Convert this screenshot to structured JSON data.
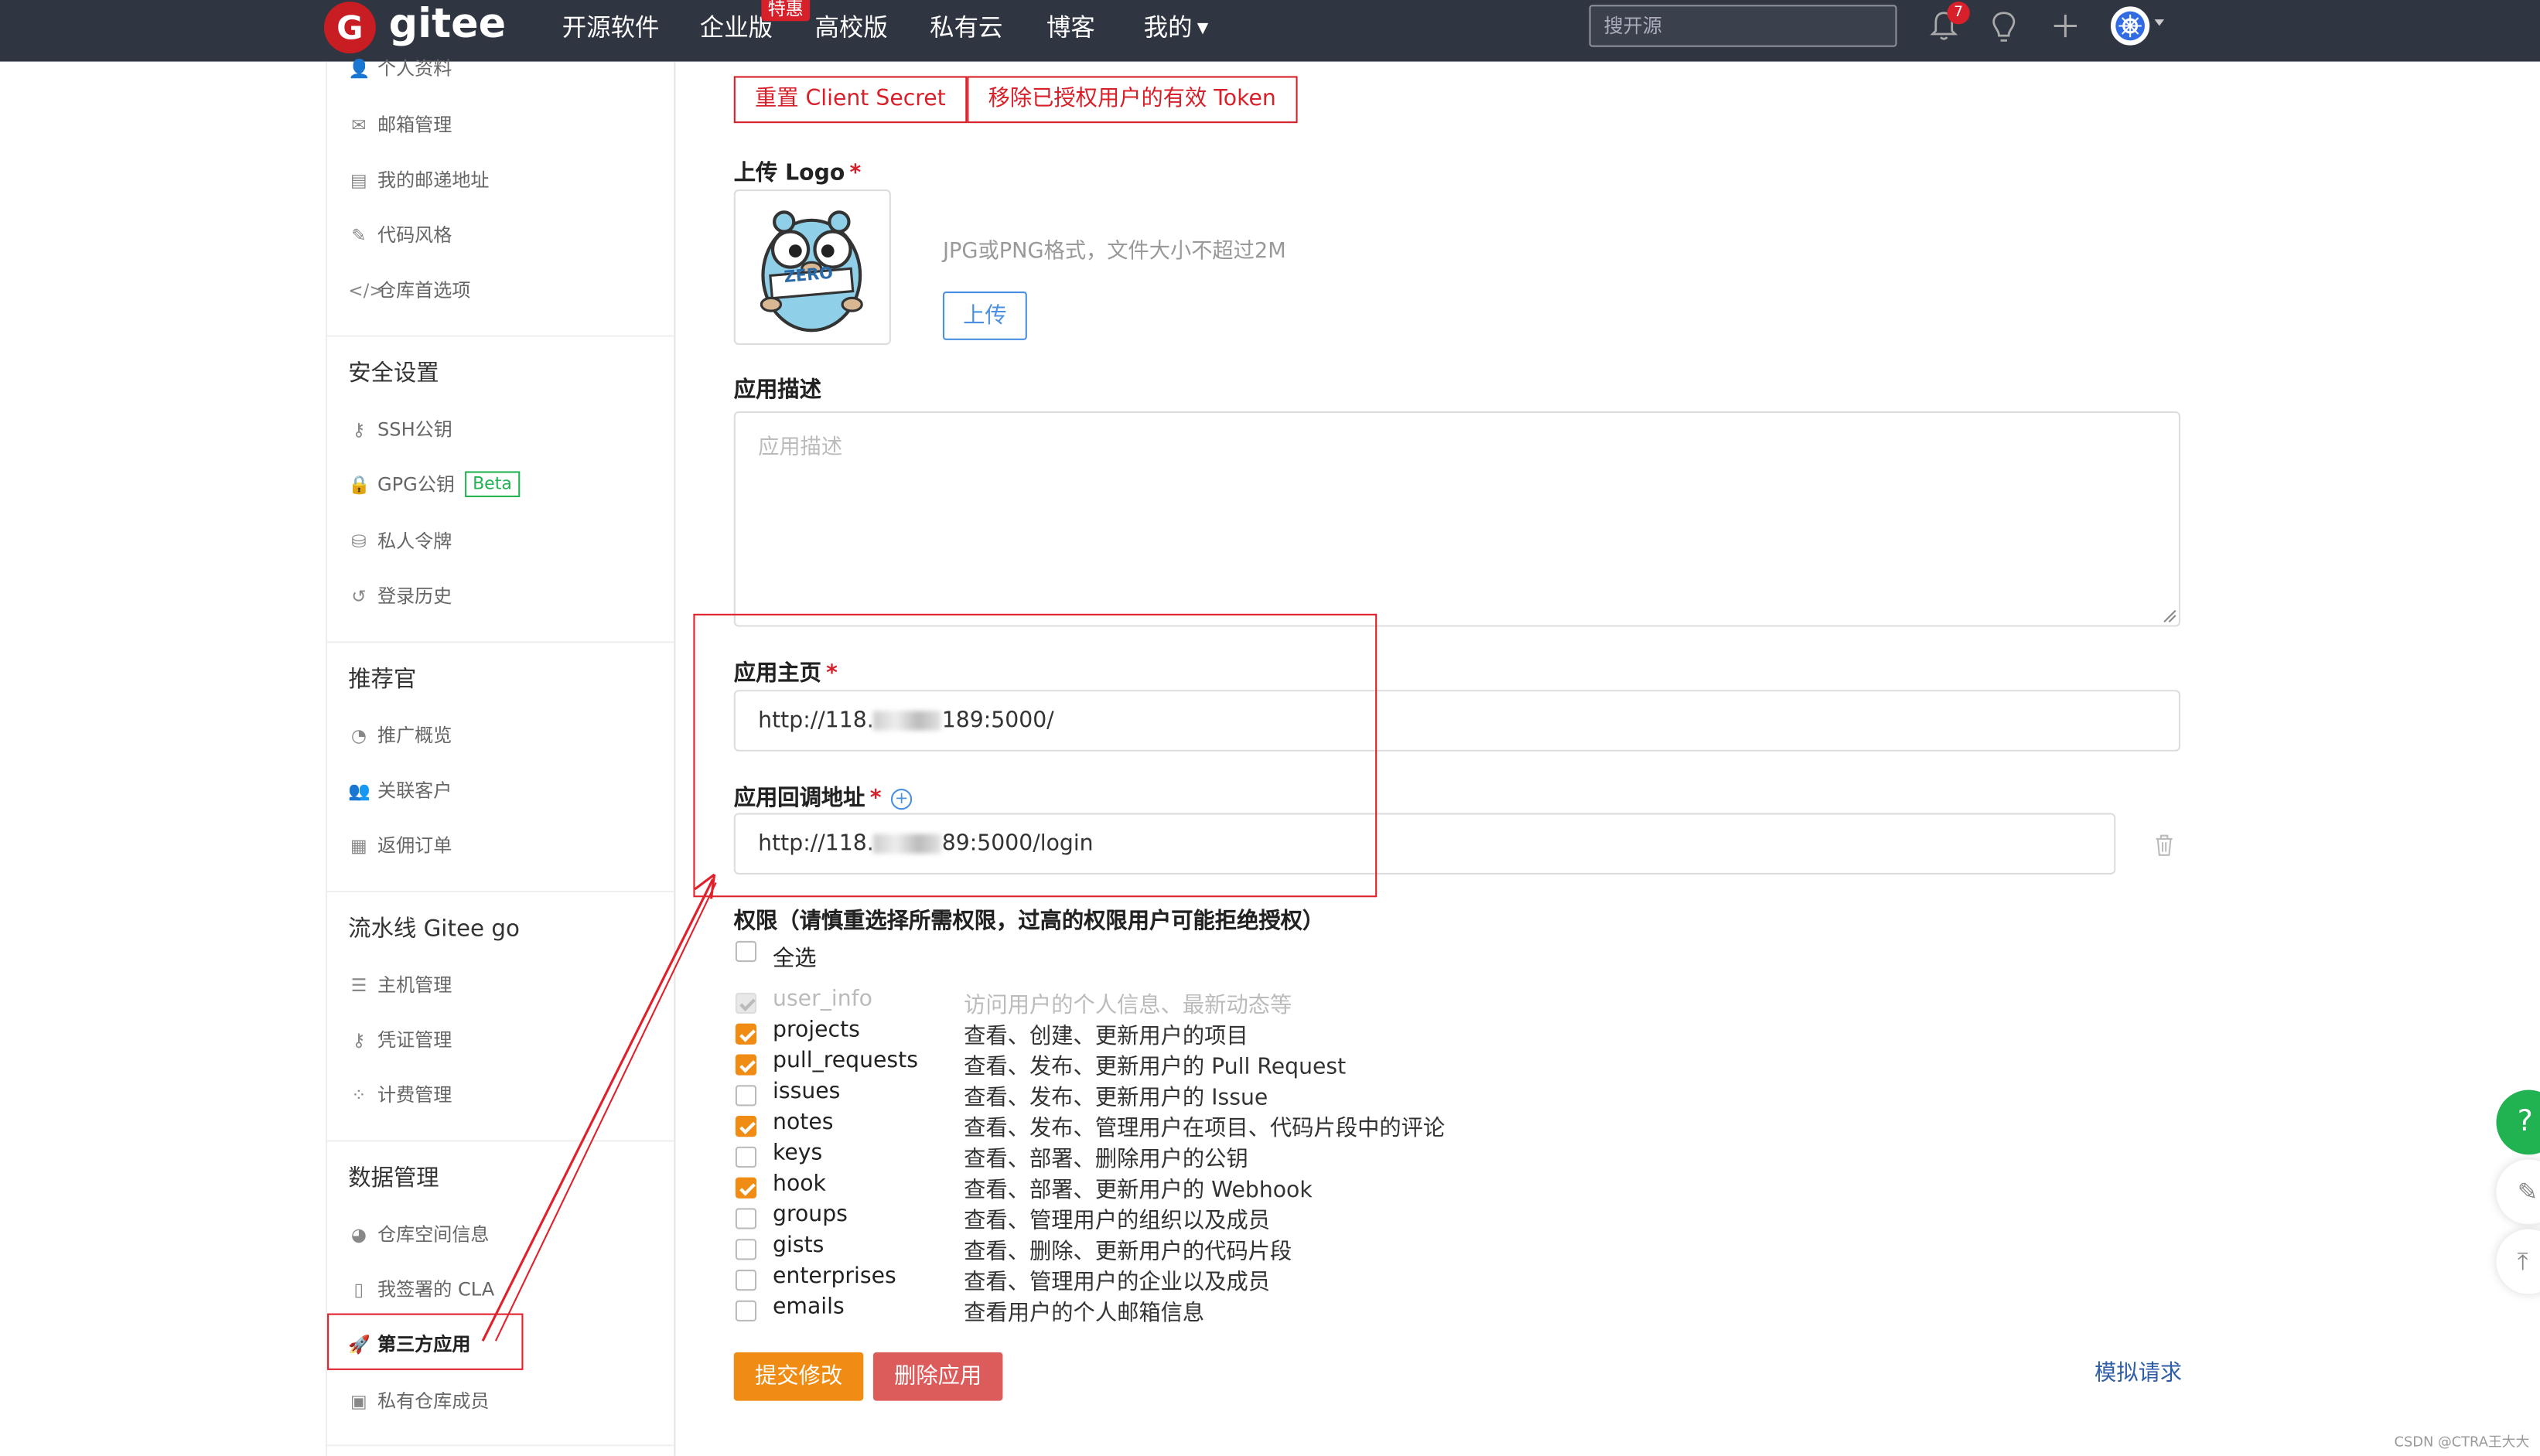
{
  "nav": {
    "logo_letter": "G",
    "logo_text": "gitee",
    "items": [
      "开源软件",
      "企业版",
      "高校版",
      "私有云",
      "博客",
      "我的"
    ],
    "hot_badge": "特惠",
    "search_placeholder": "搜开源",
    "notification_count": "7",
    "icons": [
      "bell-icon",
      "lightbulb-icon",
      "plus-icon",
      "avatar"
    ]
  },
  "sidebar": {
    "top_items": [
      {
        "label": "个人资料",
        "icon": "user-icon"
      },
      {
        "label": "邮箱管理",
        "icon": "mail-icon"
      },
      {
        "label": "我的邮递地址",
        "icon": "address-card-icon"
      },
      {
        "label": "代码风格",
        "icon": "brush-icon"
      },
      {
        "label": "仓库首选项",
        "icon": "code-icon"
      }
    ],
    "security": {
      "heading": "安全设置",
      "items": [
        {
          "label": "SSH公钥",
          "icon": "key-icon"
        },
        {
          "label": "GPG公钥",
          "icon": "lock-icon",
          "badge": "Beta"
        },
        {
          "label": "私人令牌",
          "icon": "token-icon"
        },
        {
          "label": "登录历史",
          "icon": "history-icon"
        }
      ]
    },
    "referral": {
      "heading": "推荐官",
      "items": [
        {
          "label": "推广概览",
          "icon": "chart-icon"
        },
        {
          "label": "关联客户",
          "icon": "users-icon"
        },
        {
          "label": "返佣订单",
          "icon": "order-icon"
        }
      ]
    },
    "pipeline": {
      "heading": "流水线 Gitee go",
      "items": [
        {
          "label": "主机管理",
          "icon": "server-icon"
        },
        {
          "label": "凭证管理",
          "icon": "key-icon"
        },
        {
          "label": "计费管理",
          "icon": "billing-icon"
        }
      ]
    },
    "data": {
      "heading": "数据管理",
      "items": [
        {
          "label": "仓库空间信息",
          "icon": "pie-icon"
        },
        {
          "label": "我签署的 CLA",
          "icon": "file-icon"
        },
        {
          "label": "第三方应用",
          "icon": "rocket-icon",
          "active": true
        },
        {
          "label": "私有仓库成员",
          "icon": "member-icon"
        }
      ]
    }
  },
  "main": {
    "reset_secret_btn": "重置 Client Secret",
    "revoke_tokens_btn": "移除已授权用户的有效 Token",
    "logo_label": "上传 Logo",
    "logo_hint": "JPG或PNG格式，文件大小不超过2M",
    "upload_btn": "上传",
    "logo_caption": "ZERO",
    "desc_label": "应用描述",
    "desc_placeholder": "应用描述",
    "homepage_label": "应用主页",
    "homepage_value_prefix": "http://118.",
    "homepage_value_suffix": "189:5000/",
    "callback_label": "应用回调地址",
    "callback_value_prefix": "http://118.",
    "callback_value_suffix": "89:5000/login",
    "required_mark": "*",
    "add_symbol": "+",
    "perm_label": "权限（请慎重选择所需权限，过高的权限用户可能拒绝授权）",
    "select_all": "全选",
    "scopes": [
      {
        "name": "user_info",
        "desc": "访问用户的个人信息、最新动态等",
        "checked": true,
        "disabled": true
      },
      {
        "name": "projects",
        "desc": "查看、创建、更新用户的项目",
        "checked": true
      },
      {
        "name": "pull_requests",
        "desc": "查看、发布、更新用户的 Pull Request",
        "checked": true
      },
      {
        "name": "issues",
        "desc": "查看、发布、更新用户的 Issue",
        "checked": false
      },
      {
        "name": "notes",
        "desc": "查看、发布、管理用户在项目、代码片段中的评论",
        "checked": true
      },
      {
        "name": "keys",
        "desc": "查看、部署、删除用户的公钥",
        "checked": false
      },
      {
        "name": "hook",
        "desc": "查看、部署、更新用户的 Webhook",
        "checked": true
      },
      {
        "name": "groups",
        "desc": "查看、管理用户的组织以及成员",
        "checked": false
      },
      {
        "name": "gists",
        "desc": "查看、删除、更新用户的代码片段",
        "checked": false
      },
      {
        "name": "enterprises",
        "desc": "查看、管理用户的企业以及成员",
        "checked": false
      },
      {
        "name": "emails",
        "desc": "查看用户的个人邮箱信息",
        "checked": false
      }
    ],
    "submit_btn": "提交修改",
    "delete_btn": "删除应用",
    "simulate_link": "模拟请求"
  },
  "floating": {
    "help": "?",
    "feedback_icon": "edit-icon",
    "top_icon": "arrow-up-icon"
  },
  "watermark": "CSDN @CTRA王大大",
  "colors": {
    "nav_bg": "#2f3541",
    "brand_red": "#c71d23",
    "accent_orange": "#f08c14",
    "danger": "#dc5c5c",
    "link_blue": "#2f5ea6",
    "help_green": "#21b351",
    "annotation_red": "#e0212b"
  }
}
